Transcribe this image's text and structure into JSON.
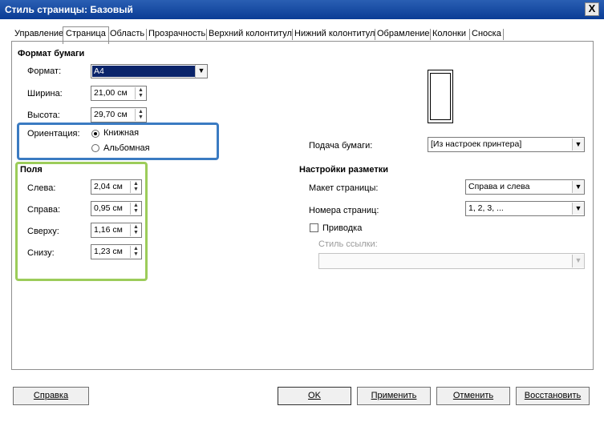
{
  "window": {
    "title": "Стиль страницы: Базовый",
    "close_glyph": "X"
  },
  "tabs": [
    {
      "label": "Управление",
      "active": false
    },
    {
      "label": "Страница",
      "active": true
    },
    {
      "label": "Область",
      "active": false
    },
    {
      "label": "Прозрачность",
      "active": false
    },
    {
      "label": "Верхний колонтитул",
      "active": false
    },
    {
      "label": "Нижний колонтитул",
      "active": false
    },
    {
      "label": "Обрамление",
      "active": false
    },
    {
      "label": "Колонки",
      "active": false
    },
    {
      "label": "Сноска",
      "active": false
    }
  ],
  "paper": {
    "heading": "Формат бумаги",
    "format_label": "Формат:",
    "format_value": "A4",
    "width_label": "Ширина:",
    "width_value": "21,00 см",
    "height_label": "Высота:",
    "height_value": "29,70 см",
    "orientation_label": "Ориентация:",
    "portrait_label": "Книжная",
    "landscape_label": "Альбомная",
    "selected_orientation": "portrait",
    "tray_label": "Подача бумаги:",
    "tray_value": "[Из настроек принтера]"
  },
  "margins": {
    "heading": "Поля",
    "left_label": "Слева:",
    "left_value": "2,04 см",
    "right_label": "Справа:",
    "right_value": "0,95 см",
    "top_label": "Сверху:",
    "top_value": "1,16 см",
    "bottom_label": "Снизу:",
    "bottom_value": "1,23 см"
  },
  "layout": {
    "heading": "Настройки разметки",
    "page_layout_label": "Макет страницы:",
    "page_layout_value": "Справа и слева",
    "page_numbers_label": "Номера страниц:",
    "page_numbers_value": "1, 2, 3, ...",
    "register_label": "Приводка",
    "register_checked": false,
    "ref_style_label": "Стиль ссылки:",
    "ref_style_value": ""
  },
  "buttons": {
    "help": "Справка",
    "ok": "OK",
    "apply": "Применить",
    "cancel": "Отменить",
    "reset": "Восстановить"
  },
  "colors": {
    "titlebar": "#0a3c95",
    "orientation_highlight": "#3b7bc2",
    "margins_highlight": "#9ccc5a",
    "format_selected_bg": "#0a246a"
  },
  "icons": {
    "spin": "spin-up-down-icon",
    "dropdown": "chevron-down-icon"
  }
}
